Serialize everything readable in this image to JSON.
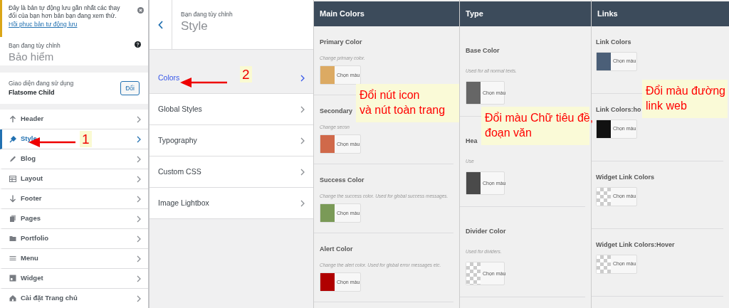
{
  "notice": {
    "text": "Đây là bản tự động lưu gần nhất các thay đổi của bạn hơn bản bạn đang xem thử.",
    "link": "Hồi phục bản tự động lưu"
  },
  "customizing": {
    "label": "Bạn đang tùy chỉnh",
    "title": "Bảo hiểm"
  },
  "theme": {
    "label": "Giao diện đang sử dụng",
    "name": "Flatsome Child",
    "button": "Đổi"
  },
  "menu": [
    {
      "label": "Header",
      "selected": false
    },
    {
      "label": "Style",
      "selected": true
    },
    {
      "label": "Blog",
      "selected": false
    },
    {
      "label": "Layout",
      "selected": false
    },
    {
      "label": "Footer",
      "selected": false
    },
    {
      "label": "Pages",
      "selected": false
    },
    {
      "label": "Portfolio",
      "selected": false
    },
    {
      "label": "Menu",
      "selected": false
    },
    {
      "label": "Widget",
      "selected": false
    },
    {
      "label": "Cài đặt Trang chủ",
      "selected": false
    }
  ],
  "section": {
    "label": "Bạn đang tùy chỉnh",
    "title": "Style",
    "items": [
      {
        "label": "Colors",
        "selected": true
      },
      {
        "label": "Global Styles",
        "selected": false
      },
      {
        "label": "Typography",
        "selected": false
      },
      {
        "label": "Custom CSS",
        "selected": false
      },
      {
        "label": "Image Lightbox",
        "selected": false
      }
    ]
  },
  "panels": [
    {
      "title": "Main Colors",
      "controls": [
        {
          "label": "Primary Color",
          "description": "Change primary color.",
          "kind": "solid",
          "color": "#dcaa63",
          "button": "Chọn màu"
        },
        {
          "label": "Secondary",
          "description": "Change secon",
          "kind": "solid",
          "color": "#d0694a",
          "button": "Chọn màu"
        },
        {
          "label": "Success Color",
          "description": "Change the success color. Used for global success messages.",
          "kind": "solid",
          "color": "#7a9a57",
          "button": "Chọn màu"
        },
        {
          "label": "Alert Color",
          "description": "Change the alert color. Used for global error messages etc.",
          "kind": "solid",
          "color": "#b00000",
          "button": "Chọn màu"
        }
      ]
    },
    {
      "title": "Type",
      "controls": [
        {
          "label": "Base Color",
          "description": "Used for all normal texts.",
          "kind": "solid",
          "color": "#666666",
          "button": "Chọn màu"
        },
        {
          "label": "Hea",
          "description": "Use",
          "kind": "solid",
          "color": "#4a4a4a",
          "button": "Chọn màu"
        },
        {
          "label": "Divider Color",
          "description": "Used for dividers.",
          "kind": "transparent",
          "button": "Chọn màu"
        }
      ]
    },
    {
      "title": "Links",
      "controls": [
        {
          "label": "Link Colors",
          "kind": "solid",
          "color": "#4b5f78",
          "button": "Chọn màu"
        },
        {
          "label": "Link Colors:ho",
          "kind": "solid",
          "color": "#111111",
          "button": "Chọn màu"
        },
        {
          "label": "Widget Link Colors",
          "kind": "transparent",
          "button": "Chọn màu"
        },
        {
          "label": "Widget Link Colors:Hover",
          "kind": "transparent",
          "button": "Chọn màu"
        }
      ]
    }
  ],
  "annotations": [
    {
      "kind": "step",
      "text": "1"
    },
    {
      "kind": "step",
      "text": "2"
    },
    {
      "kind": "callout",
      "lines": [
        "Đổi nút icon",
        "và nút toàn trang"
      ]
    },
    {
      "kind": "callout",
      "lines": [
        "Đổi màu Chữ tiêu đề,",
        "đoạn văn"
      ]
    },
    {
      "kind": "callout",
      "lines": [
        "Đổi màu đường",
        "link web"
      ]
    }
  ]
}
